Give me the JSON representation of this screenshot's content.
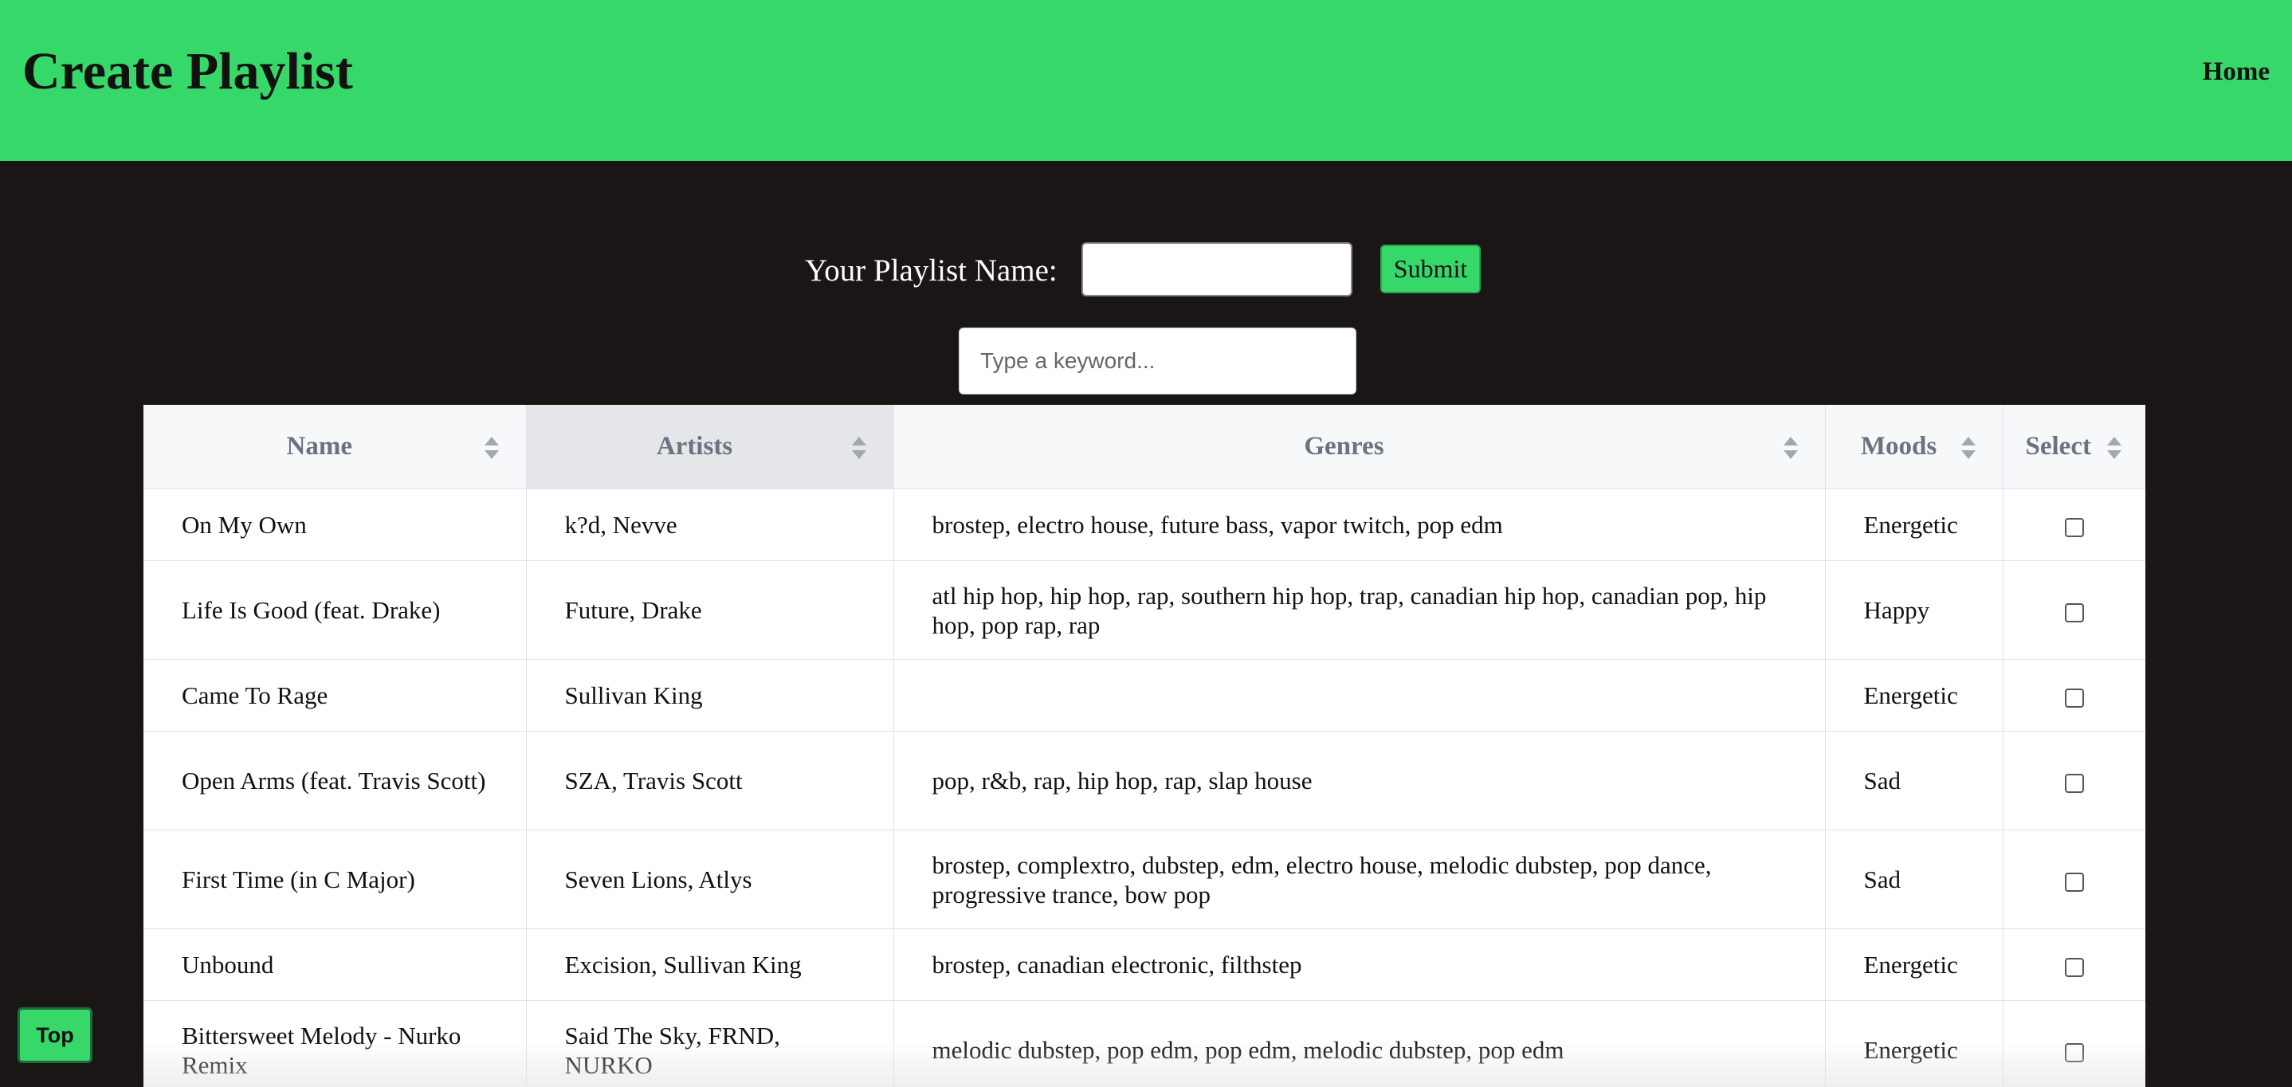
{
  "header": {
    "title": "Create Playlist",
    "home_link": "Home",
    "background_color": "#37d86a"
  },
  "form": {
    "playlist_name_label": "Your Playlist Name:",
    "playlist_name_value": "",
    "submit_label": "Submit",
    "search_placeholder": "Type a keyword...",
    "search_value": ""
  },
  "table": {
    "columns": [
      "Name",
      "Artists",
      "Genres",
      "Moods",
      "Select"
    ],
    "sorted_column": "Artists",
    "rows": [
      {
        "name": "On My Own",
        "artists": "k?d, Nevve",
        "genres": "brostep, electro house, future bass, vapor twitch, pop edm",
        "mood": "Energetic",
        "selected": false
      },
      {
        "name": "Life Is Good (feat. Drake)",
        "artists": "Future, Drake",
        "genres": "atl hip hop, hip hop, rap, southern hip hop, trap, canadian hip hop, canadian pop, hip hop, pop rap, rap",
        "mood": "Happy",
        "selected": false
      },
      {
        "name": "Came To Rage",
        "artists": "Sullivan King",
        "genres": "",
        "mood": "Energetic",
        "selected": false
      },
      {
        "name": "Open Arms (feat. Travis Scott)",
        "artists": "SZA, Travis Scott",
        "genres": "pop, r&b, rap, hip hop, rap, slap house",
        "mood": "Sad",
        "selected": false
      },
      {
        "name": "First Time (in C Major)",
        "artists": "Seven Lions, Atlys",
        "genres": "brostep, complextro, dubstep, edm, electro house, melodic dubstep, pop dance, progressive trance, bow pop",
        "mood": "Sad",
        "selected": false
      },
      {
        "name": "Unbound",
        "artists": "Excision, Sullivan King",
        "genres": "brostep, canadian electronic, filthstep",
        "mood": "Energetic",
        "selected": false
      },
      {
        "name": "Bittersweet Melody - Nurko Remix",
        "artists": "Said The Sky, FRND, NURKO",
        "genres": "melodic dubstep, pop edm, pop edm, melodic dubstep, pop edm",
        "mood": "Energetic",
        "selected": false
      }
    ]
  },
  "top_button_label": "Top"
}
